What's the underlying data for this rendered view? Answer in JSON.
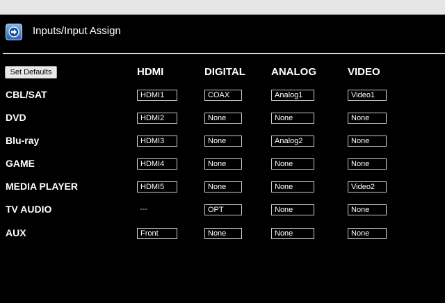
{
  "header": {
    "title": "Inputs/Input Assign",
    "icon": "arrow-right-icon"
  },
  "set_defaults_label": "Set Defaults",
  "columns": [
    "HDMI",
    "DIGITAL",
    "ANALOG",
    "VIDEO"
  ],
  "rows": [
    {
      "label": "CBL/SAT",
      "hdmi": "HDMI1",
      "digital": "COAX",
      "analog": "Analog1",
      "video": "Video1"
    },
    {
      "label": "DVD",
      "hdmi": "HDMI2",
      "digital": "None",
      "analog": "None",
      "video": "None"
    },
    {
      "label": "Blu-ray",
      "hdmi": "HDMI3",
      "digital": "None",
      "analog": "Analog2",
      "video": "None"
    },
    {
      "label": "GAME",
      "hdmi": "HDMI4",
      "digital": "None",
      "analog": "None",
      "video": "None"
    },
    {
      "label": "MEDIA PLAYER",
      "hdmi": "HDMI5",
      "digital": "None",
      "analog": "None",
      "video": "Video2"
    },
    {
      "label": "TV AUDIO",
      "hdmi": "---",
      "digital": "OPT",
      "analog": "None",
      "video": "None"
    },
    {
      "label": "AUX",
      "hdmi": "Front",
      "digital": "None",
      "analog": "None",
      "video": "None"
    }
  ]
}
